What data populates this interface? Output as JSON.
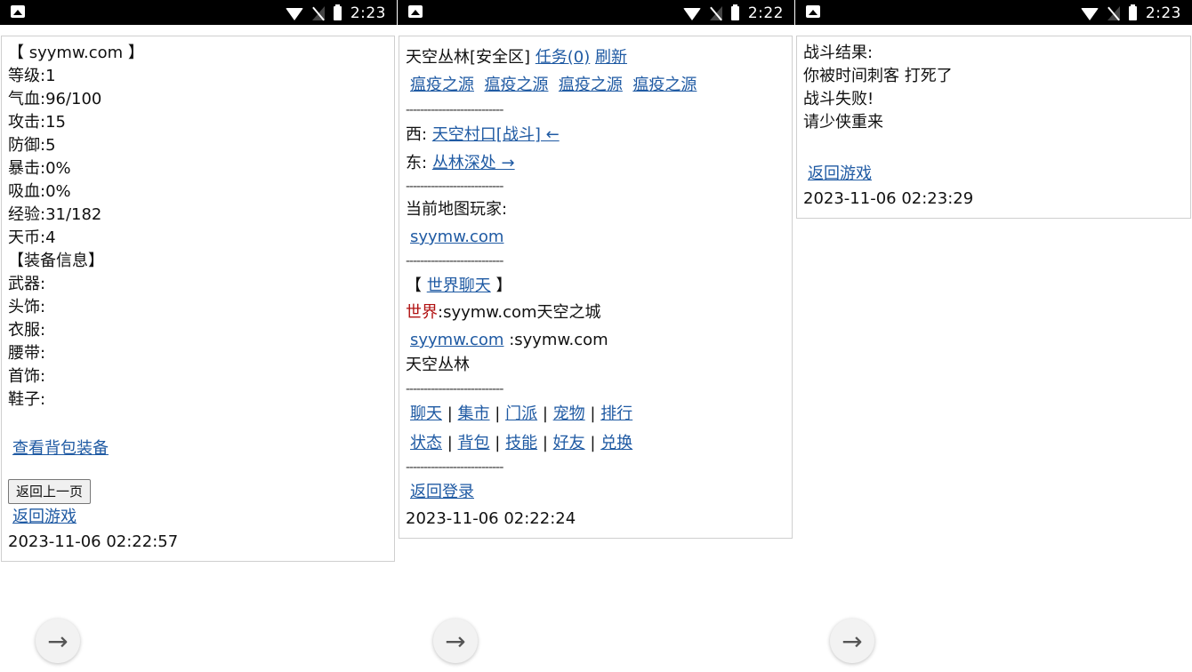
{
  "screens": [
    {
      "clock": "2:23",
      "lines": [
        "【 syymw.com 】",
        "等级:1",
        "气血:96/100",
        "攻击:15",
        "防御:5",
        "暴击:0%",
        "吸血:0%",
        "经验:31/182",
        "天币:4",
        "【装备信息】",
        "武器:",
        "头饰:",
        "衣服:",
        "腰带:",
        "首饰:",
        "鞋子:"
      ],
      "view_bag_link": "查看背包装备",
      "back_button": "返回上一页",
      "return_game_link": "返回游戏",
      "timestamp": "2023-11-06 02:22:57"
    },
    {
      "clock": "2:22",
      "location": "天空丛林[安全区]",
      "task_link": "任务(0)",
      "refresh_link": "刷新",
      "monsters": [
        "瘟疫之源",
        "瘟疫之源",
        "瘟疫之源",
        "瘟疫之源"
      ],
      "separator": "---------------------------",
      "west_label": "西:",
      "west_link": "天空村口[战斗] ←",
      "east_label": "东:",
      "east_link": "丛林深处 →",
      "players_label": "当前地图玩家:",
      "player_link": "syymw.com",
      "chat_open": "【",
      "chat_link": "世界聊天",
      "chat_close": "】",
      "world_label": "世界",
      "world_message": ":syymw.com天空之城",
      "chat_user_link": "syymw.com",
      "chat_user_msg": ":syymw.com",
      "chat_user_msg2": "天空丛林",
      "menu_row1": [
        "聊天",
        "集市",
        "门派",
        "宠物",
        "排行"
      ],
      "menu_row2": [
        "状态",
        "背包",
        "技能",
        "好友",
        "兑换"
      ],
      "pipe": "|",
      "return_login_link": "返回登录",
      "timestamp": "2023-11-06 02:22:24"
    },
    {
      "clock": "2:23",
      "lines": [
        "战斗结果:",
        "你被时间刺客 打死了",
        "战斗失败!",
        "请少侠重来"
      ],
      "return_game_link": "返回游戏",
      "timestamp": "2023-11-06 02:23:29"
    }
  ],
  "nav_arrow": "→"
}
